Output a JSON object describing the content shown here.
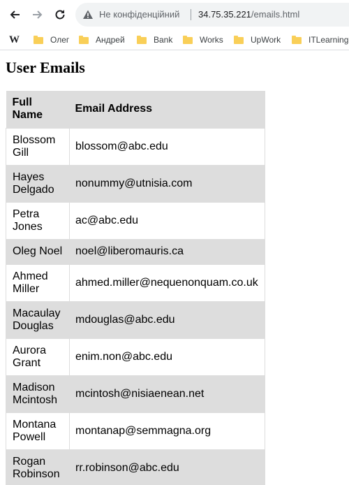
{
  "browser": {
    "security_label": "Не конфіденційний",
    "url_host": "34.75.35.221",
    "url_path": "/emails.html",
    "bookmarks": [
      {
        "label": "",
        "icon": "wikipedia-icon"
      },
      {
        "label": "Олег",
        "icon": "folder-icon"
      },
      {
        "label": "Андрей",
        "icon": "folder-icon"
      },
      {
        "label": "Bank",
        "icon": "folder-icon"
      },
      {
        "label": "Works",
        "icon": "folder-icon"
      },
      {
        "label": "UpWork",
        "icon": "folder-icon"
      },
      {
        "label": "ITLearning",
        "icon": "folder-icon"
      }
    ]
  },
  "page": {
    "title": "User Emails",
    "table": {
      "headers": [
        "Full Name",
        "Email Address"
      ],
      "rows": [
        {
          "name": "Blossom Gill",
          "email": "blossom@abc.edu"
        },
        {
          "name": "Hayes Delgado",
          "email": "nonummy@utnisia.com"
        },
        {
          "name": "Petra Jones",
          "email": "ac@abc.edu"
        },
        {
          "name": "Oleg Noel",
          "email": "noel@liberomauris.ca"
        },
        {
          "name": "Ahmed Miller",
          "email": "ahmed.miller@nequenonquam.co.uk"
        },
        {
          "name": "Macaulay Douglas",
          "email": "mdouglas@abc.edu"
        },
        {
          "name": "Aurora Grant",
          "email": "enim.non@abc.edu"
        },
        {
          "name": "Madison Mcintosh",
          "email": "mcintosh@nisiaenean.net"
        },
        {
          "name": "Montana Powell",
          "email": "montanap@semmagna.org"
        },
        {
          "name": "Rogan Robinson",
          "email": "rr.robinson@abc.edu"
        }
      ]
    }
  }
}
